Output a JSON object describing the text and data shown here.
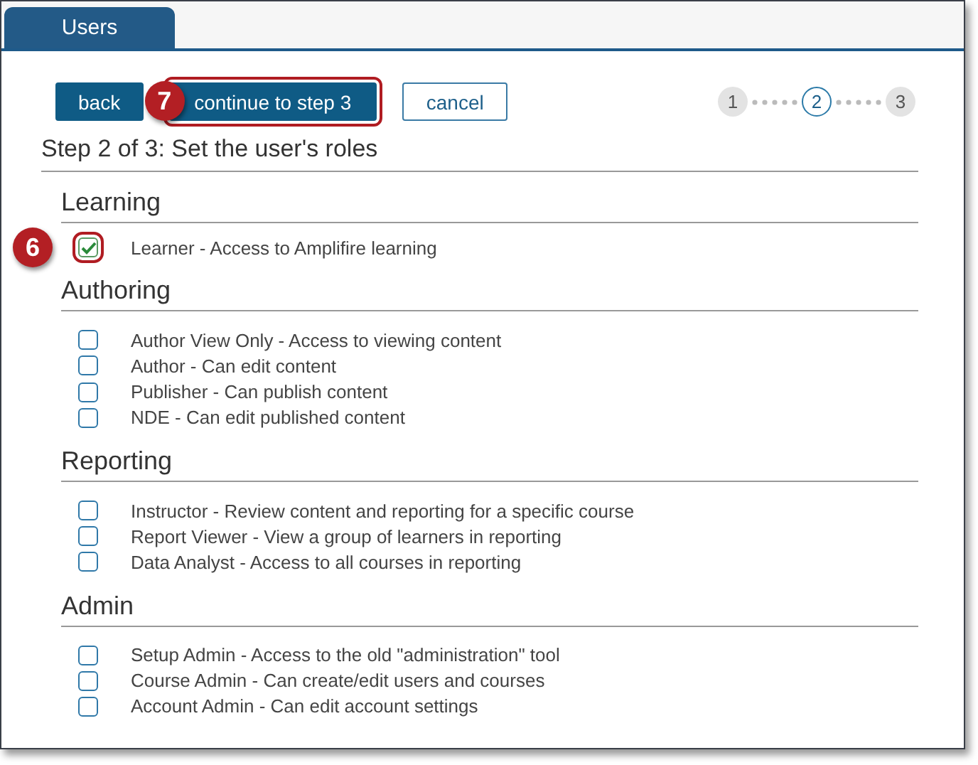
{
  "tabs": [
    {
      "label": "Users",
      "selected": true
    }
  ],
  "buttons": [
    {
      "kind": "primary",
      "label": "back"
    },
    {
      "kind": "primary",
      "label": "continue to step 3",
      "callout": "7"
    },
    {
      "kind": "secondary",
      "label": "cancel"
    }
  ],
  "steps": [
    {
      "label": "1",
      "selected": false
    },
    {
      "label": "2",
      "selected": true
    },
    {
      "label": "3",
      "selected": false
    }
  ],
  "heading": "Step 2 of 3: Set the user's roles",
  "sections": [
    {
      "title": "Learning",
      "roles": [
        {
          "label": "Learner - Access to Amplifire learning",
          "checked": true,
          "callout": "6"
        }
      ]
    },
    {
      "title": "Authoring",
      "roles": [
        {
          "label": "Author View Only - Access to viewing content",
          "checked": false
        },
        {
          "label": "Author - Can edit content",
          "checked": false
        },
        {
          "label": "Publisher - Can publish content",
          "checked": false
        },
        {
          "label": "NDE - Can edit published content",
          "checked": false
        }
      ]
    },
    {
      "title": "Reporting",
      "roles": [
        {
          "label": "Instructor - Review content and reporting for a specific course",
          "checked": false
        },
        {
          "label": "Report Viewer - View a group of learners in reporting",
          "checked": false
        },
        {
          "label": "Data Analyst - Access to all courses in reporting",
          "checked": false
        }
      ]
    },
    {
      "title": "Admin",
      "roles": [
        {
          "label": "Setup Admin - Access to the old \"administration\" tool",
          "checked": false
        },
        {
          "label": "Course Admin - Can create/edit users and courses",
          "checked": false
        },
        {
          "label": "Account Admin - Can edit account settings",
          "checked": false
        }
      ]
    }
  ]
}
